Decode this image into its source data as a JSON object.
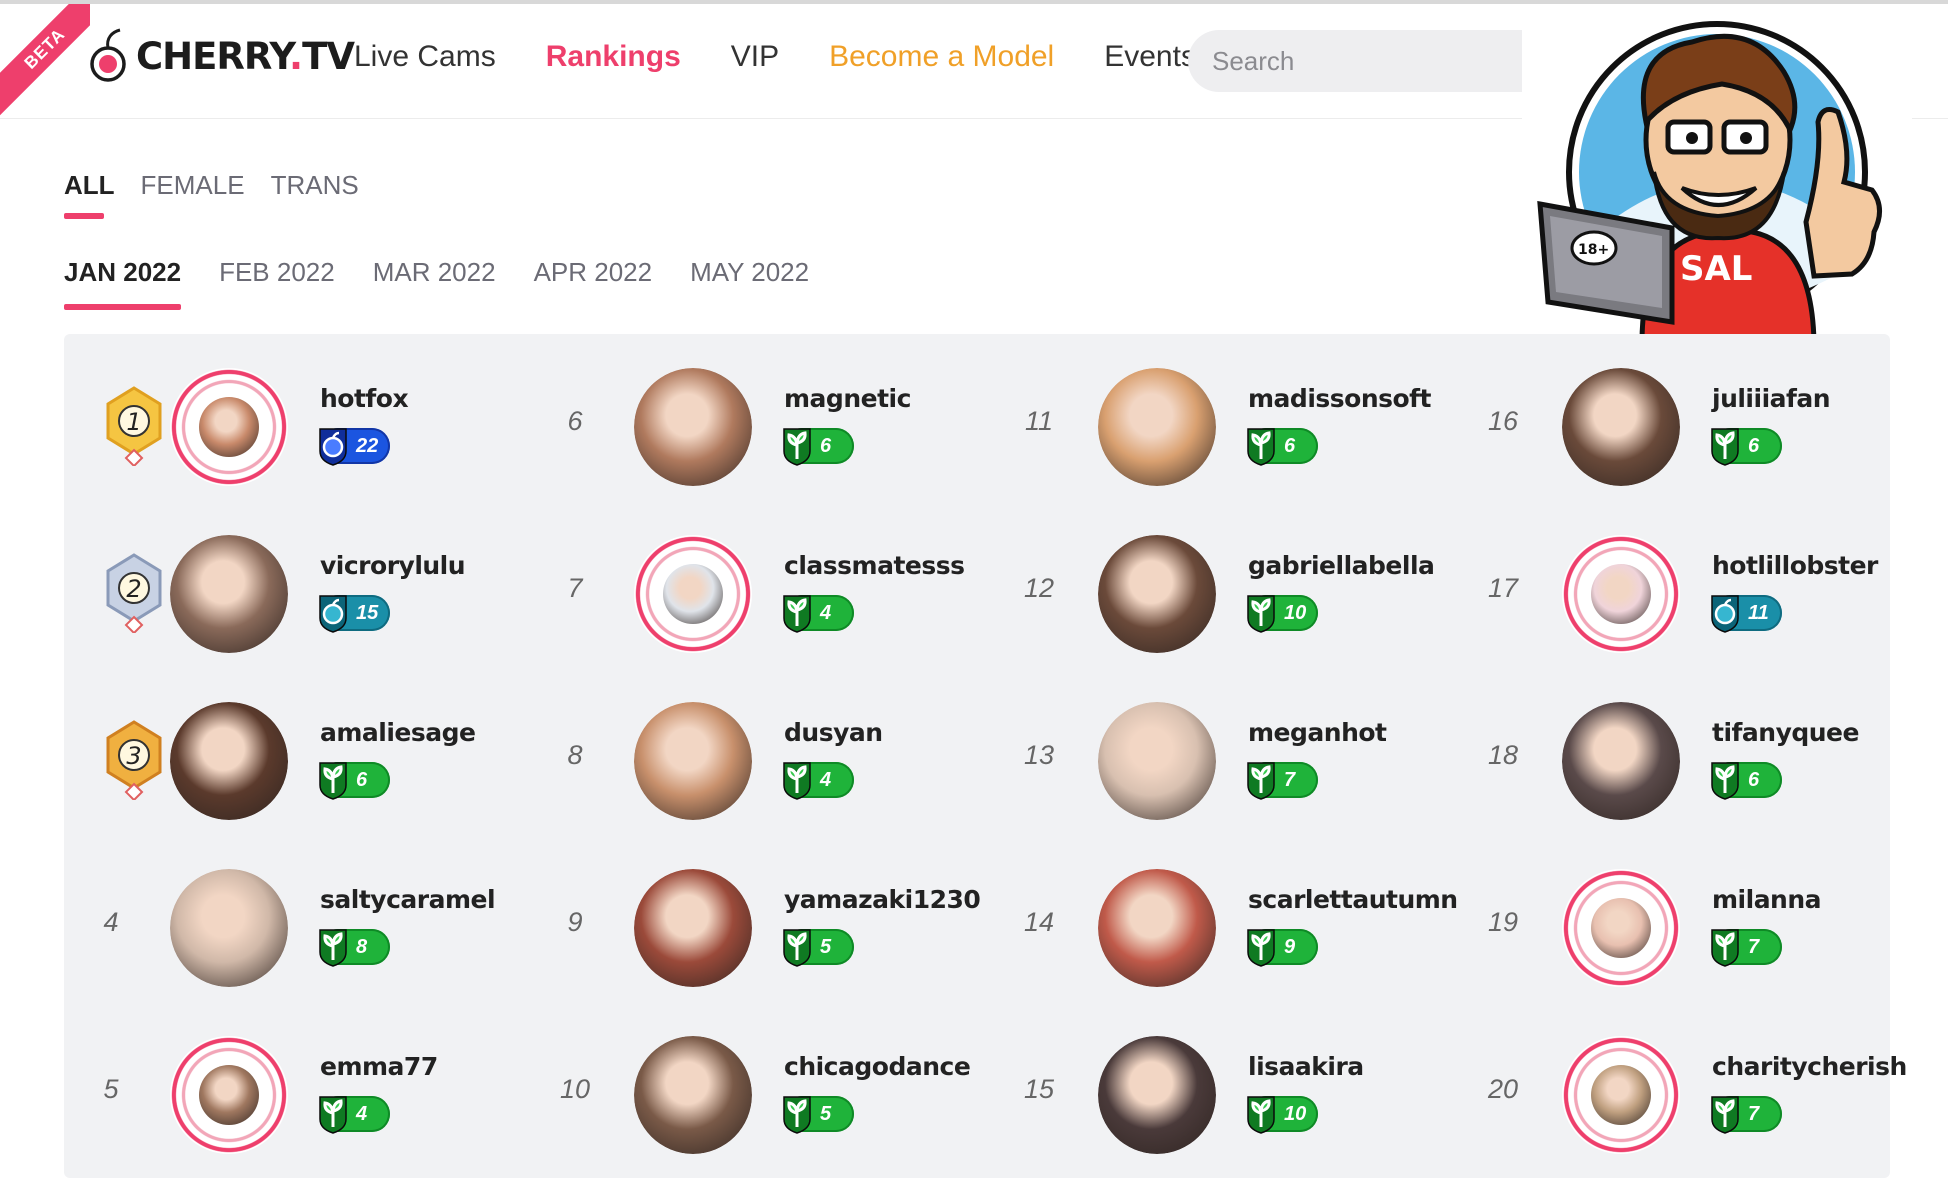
{
  "header": {
    "beta": "BETA",
    "logo_main": "CHERRY",
    "logo_dot": ".",
    "logo_tld": "TV",
    "nav": [
      "Live Cams",
      "Rankings",
      "VIP",
      "Become a Model",
      "Events"
    ],
    "search_placeholder": "Search"
  },
  "mascot": {
    "label": "SAL",
    "sticker": "18+"
  },
  "filters": {
    "gender_tabs": [
      "ALL",
      "FEMALE",
      "TRANS"
    ],
    "active_gender": "ALL",
    "month_tabs": [
      "JAN 2022",
      "FEB 2022",
      "MAR 2022",
      "APR 2022",
      "MAY 2022"
    ],
    "active_month": "JAN 2022"
  },
  "colors": {
    "accent": "#ee3f6c",
    "model_link": "#f0a028",
    "badge_green": "#1fb33a",
    "badge_teal": "#1a8fa8",
    "badge_blue": "#1b55e0"
  },
  "rankings": [
    {
      "rank": "1",
      "name": "hotfox",
      "level": "22",
      "badge": "blue",
      "ring": true,
      "medal": "gold"
    },
    {
      "rank": "2",
      "name": "vicrorylulu",
      "level": "15",
      "badge": "teal",
      "ring": false,
      "medal": "silver"
    },
    {
      "rank": "3",
      "name": "amaliesage",
      "level": "6",
      "badge": "green",
      "ring": false,
      "medal": "bronze"
    },
    {
      "rank": "4",
      "name": "saltycaramel",
      "level": "8",
      "badge": "green",
      "ring": false
    },
    {
      "rank": "5",
      "name": "emma77",
      "level": "4",
      "badge": "green",
      "ring": true
    },
    {
      "rank": "6",
      "name": "magnetic",
      "level": "6",
      "badge": "green",
      "ring": false
    },
    {
      "rank": "7",
      "name": "classmatesss",
      "level": "4",
      "badge": "green",
      "ring": true
    },
    {
      "rank": "8",
      "name": "dusyan",
      "level": "4",
      "badge": "green",
      "ring": false
    },
    {
      "rank": "9",
      "name": "yamazaki1230",
      "level": "5",
      "badge": "green",
      "ring": false
    },
    {
      "rank": "10",
      "name": "chicagodance",
      "level": "5",
      "badge": "green",
      "ring": false
    },
    {
      "rank": "11",
      "name": "madissonsoft",
      "level": "6",
      "badge": "green",
      "ring": false
    },
    {
      "rank": "12",
      "name": "gabriellabella",
      "level": "10",
      "badge": "green",
      "ring": false
    },
    {
      "rank": "13",
      "name": "meganhot",
      "level": "7",
      "badge": "green",
      "ring": false
    },
    {
      "rank": "14",
      "name": "scarlettautumn",
      "level": "9",
      "badge": "green",
      "ring": false
    },
    {
      "rank": "15",
      "name": "lisaakira",
      "level": "10",
      "badge": "green",
      "ring": false
    },
    {
      "rank": "16",
      "name": "juliiiafan",
      "level": "6",
      "badge": "green",
      "ring": false
    },
    {
      "rank": "17",
      "name": "hotlillobster",
      "level": "11",
      "badge": "teal",
      "ring": true
    },
    {
      "rank": "18",
      "name": "tifanyquee",
      "level": "6",
      "badge": "green",
      "ring": false
    },
    {
      "rank": "19",
      "name": "milanna",
      "level": "7",
      "badge": "green",
      "ring": true
    },
    {
      "rank": "20",
      "name": "charitycherish",
      "level": "7",
      "badge": "green",
      "ring": true
    }
  ]
}
